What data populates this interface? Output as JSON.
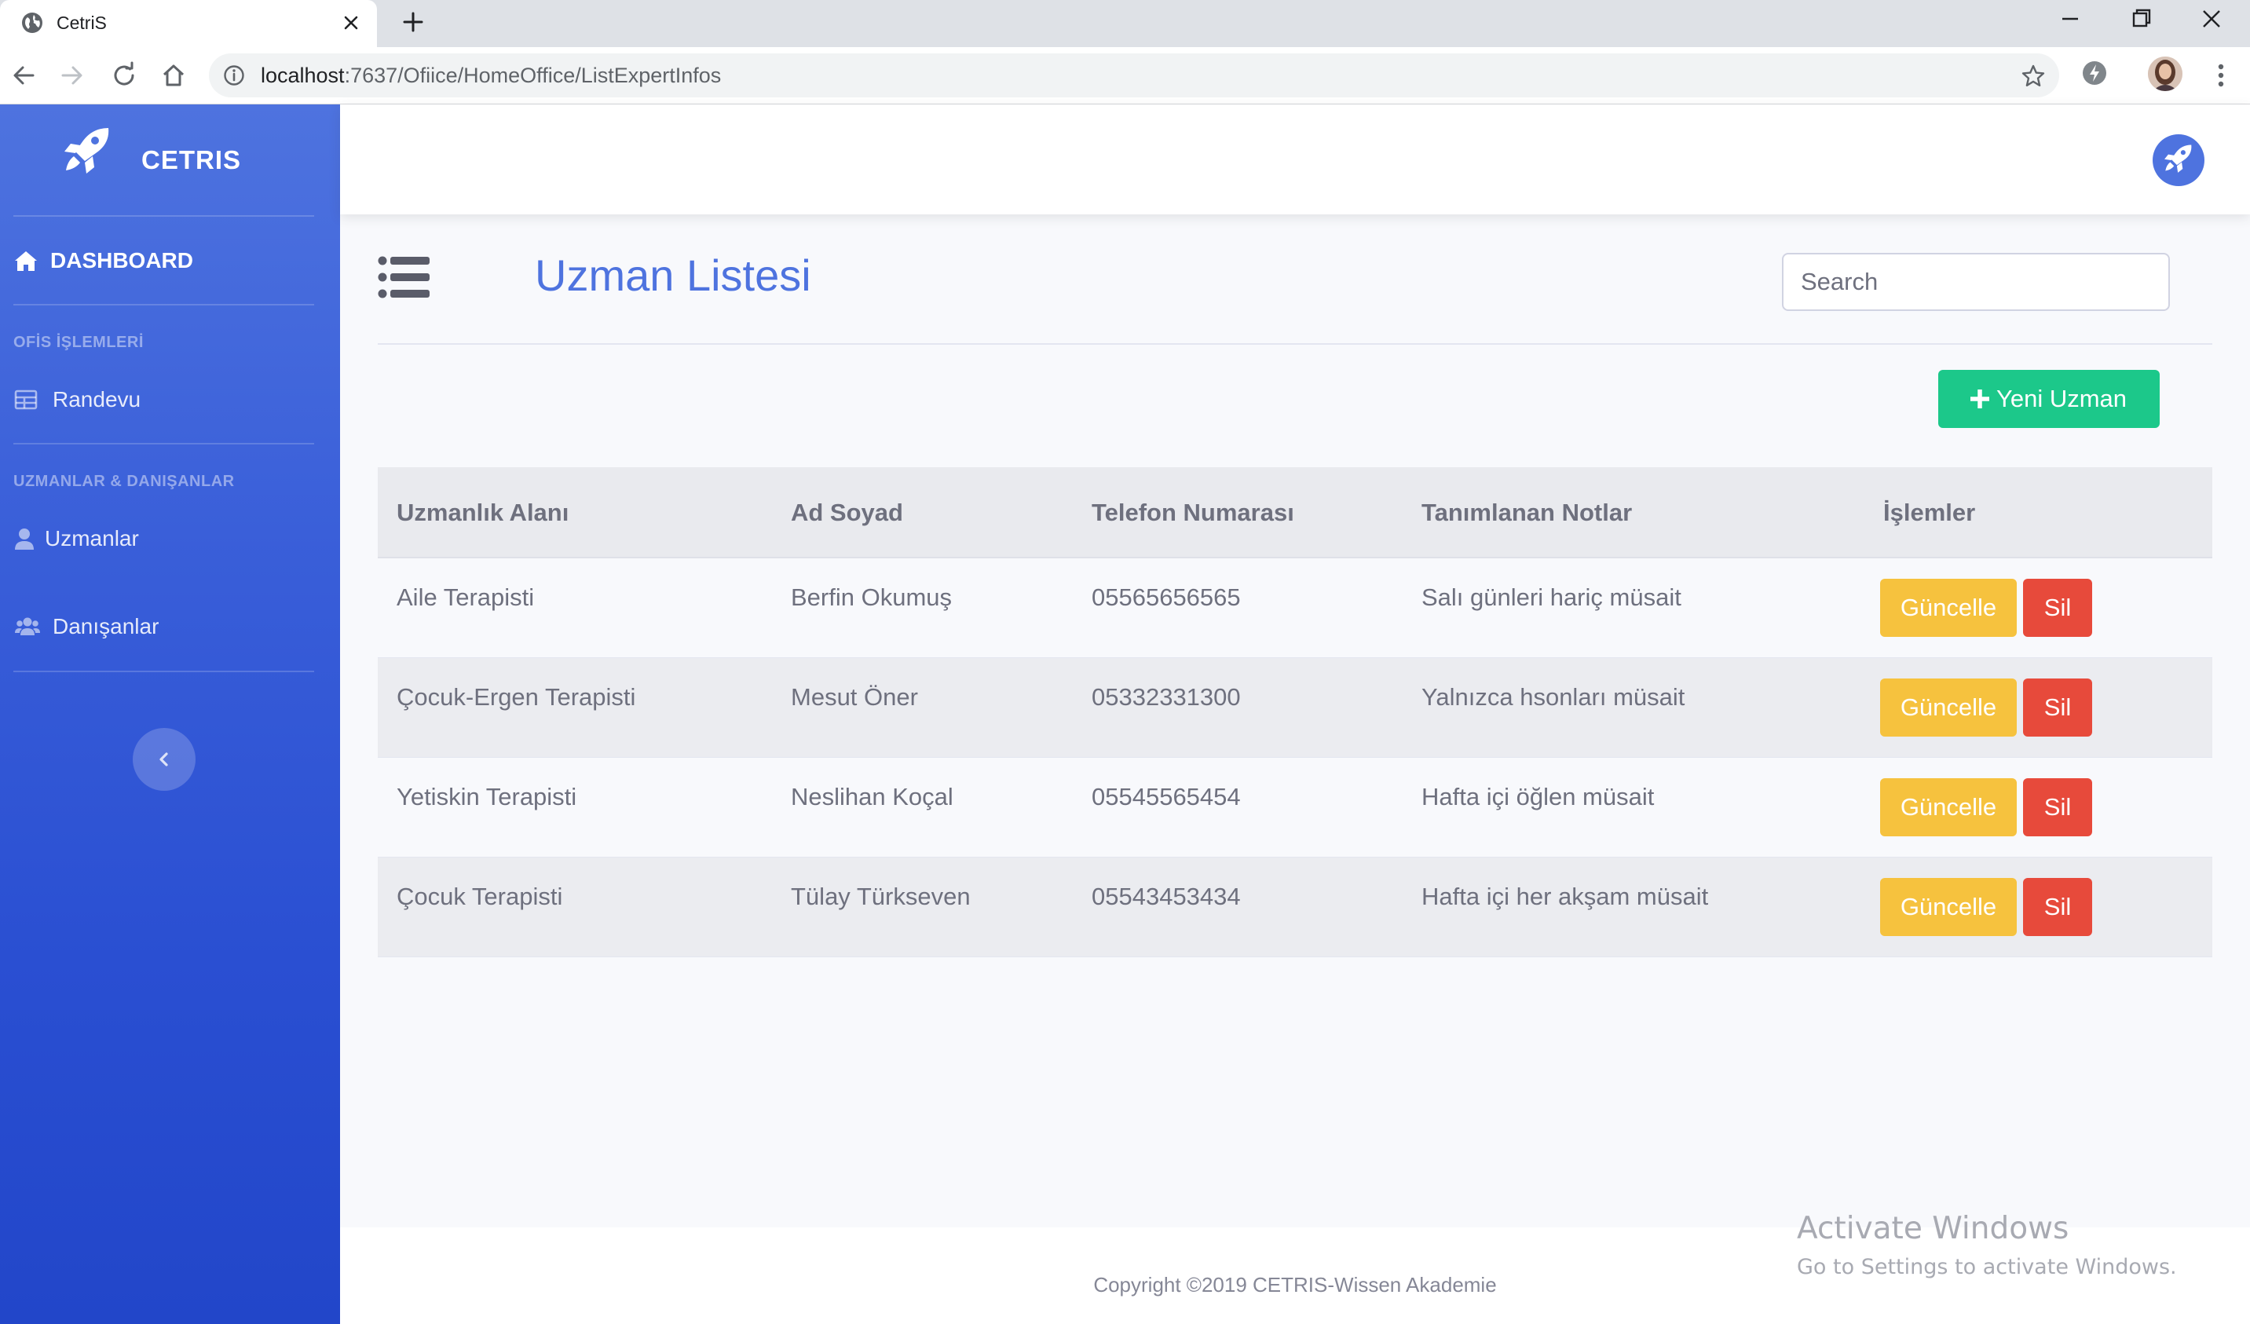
{
  "browser": {
    "tab_title": "CetriS",
    "url_host": "localhost",
    "url_path": ":7637/Ofiice/HomeOffice/ListExpertInfos"
  },
  "sidebar": {
    "brand": "CETRIS",
    "dashboard_label": "DASHBOARD",
    "section_office": "OFİS İŞLEMLERİ",
    "appointment_label": "Randevu",
    "section_people": "UZMANLAR & DANIŞANLAR",
    "experts_label": "Uzmanlar",
    "clients_label": "Danışanlar"
  },
  "page": {
    "title": "Uzman Listesi",
    "search_placeholder": "Search",
    "add_button_label": "Yeni Uzman"
  },
  "table": {
    "headers": [
      "Uzmanlık Alanı",
      "Ad Soyad",
      "Telefon Numarası",
      "Tanımlanan Notlar",
      "İşlemler"
    ],
    "rows": [
      {
        "specialty": "Aile Terapisti",
        "name": "Berfin Okumuş",
        "phone": "05565656565",
        "notes": "Salı günleri hariç müsait"
      },
      {
        "specialty": "Çocuk-Ergen Terapisti",
        "name": "Mesut Öner",
        "phone": "05332331300",
        "notes": "Yalnızca hsonları müsait"
      },
      {
        "specialty": "Yetiskin Terapisti",
        "name": "Neslihan Koçal",
        "phone": "05545565454",
        "notes": "Hafta içi öğlen müsait"
      },
      {
        "specialty": "Çocuk Terapisti",
        "name": "Tülay Türkseven",
        "phone": "05543453434",
        "notes": "Hafta içi her akşam müsait"
      }
    ],
    "update_label": "Güncelle",
    "delete_label": "Sil"
  },
  "footer": {
    "copyright": "Copyright ©2019 CETRIS-Wissen Akademie"
  },
  "watermark": {
    "title": "Activate Windows",
    "subtitle": "Go to Settings to activate Windows."
  },
  "colors": {
    "primary": "#4e73df",
    "success": "#1cc88a",
    "warning": "#f6c23e",
    "danger": "#e74a3b",
    "text_muted": "#6e707e"
  }
}
